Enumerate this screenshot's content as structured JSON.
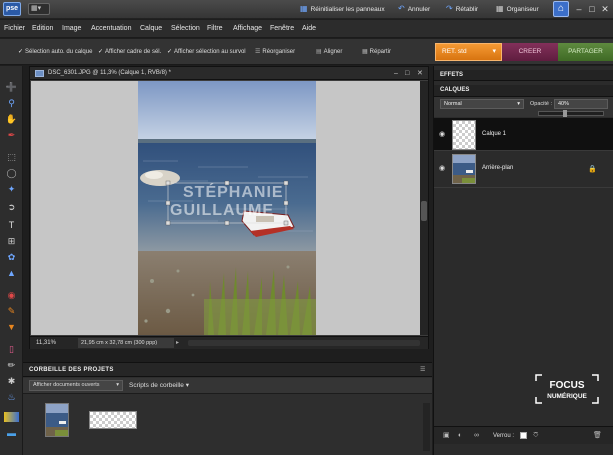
{
  "titlebar": {
    "logo": "pse",
    "workspace_icon": "▦▾",
    "reset_panels": "Réinitialiser les panneaux",
    "undo": "Annuler",
    "redo": "Rétablir",
    "organizer": "Organiseur",
    "minimize": "–",
    "maximize": "□",
    "close": "✕"
  },
  "menu": {
    "items": [
      "Fichier",
      "Edition",
      "Image",
      "Accentuation",
      "Calque",
      "Sélection",
      "Filtre",
      "Affichage",
      "Fenêtre",
      "Aide"
    ]
  },
  "options": {
    "auto_select": "Sélection auto. du calque",
    "show_bbox": "Afficher cadre de sél.",
    "show_rollover": "Afficher sélection au survol",
    "arrange": "Réorganiser",
    "align": "Aligner",
    "distribute": "Répartir"
  },
  "modes": {
    "edit": "RET. std",
    "create": "CREER",
    "share": "PARTAGER"
  },
  "document": {
    "title": "DSC_6301.JPG @ 11,3% (Calque 1, RVB/8) *",
    "zoom": "11,31%",
    "dimensions": "21,95 cm x 32,78 cm (300 ppp)",
    "watermark_line1": "STÉPHANIE",
    "watermark_line2": "GUILLAUME"
  },
  "project_bin": {
    "title": "CORBEILLE DES PROJETS",
    "show_docs": "Afficher documents ouverts",
    "scripts": "Scripts de corbeille"
  },
  "panels": {
    "effects": "EFFETS",
    "layers": "CALQUES",
    "blend_mode": "Normal",
    "opacity_label": "Opacité :",
    "opacity_value": "40%",
    "opacity_fraction": 0.4,
    "layer_top": "Calque 1",
    "layer_bottom": "Arrière-plan",
    "lock_label": "Verrou :"
  },
  "branding": {
    "line1": "FOCUS",
    "line2": "NUMÉRIQUE"
  },
  "colors": {
    "accent_orange": "#e8861f",
    "create_purple": "#6d2449",
    "share_green": "#4b7a2f",
    "app_bg": "#2b2b2b"
  }
}
